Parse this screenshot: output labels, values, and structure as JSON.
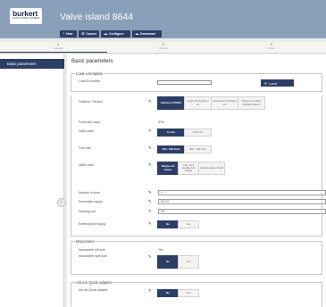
{
  "header": {
    "logo_word": "burkert",
    "logo_sub": "FLUID CONTROL SYSTEMS",
    "title": "Valve island 8644"
  },
  "toolbar": {
    "new_label": "New",
    "cancel_label": "Cancel",
    "configure_label": "Configure",
    "download_label": "Download"
  },
  "steps": [
    {
      "num": "1",
      "label": "General"
    },
    {
      "num": "2",
      "label": "Options"
    },
    {
      "num": "3",
      "label": "Done"
    }
  ],
  "sidebar": {
    "items": [
      {
        "label": "Basic parameters",
        "active": true
      }
    ]
  },
  "main": {
    "title": "Basic parameters",
    "template": {
      "legend": "Load a template",
      "field_label": "Load ID/number",
      "field_value": "",
      "load_label": "Load"
    },
    "params": {
      "fieldbus": {
        "label": "Fieldbus / Version",
        "options": [
          "Siemens ET200S",
          "Mega I/O System / ID",
          "Rockwell / CIA Point I/O",
          "Phoenix Contact INLINE System"
        ],
        "selected": 0
      },
      "protection": {
        "label": "Protection class",
        "value": "IP20"
      },
      "valve_width": {
        "label": "Valve width",
        "options": [
          "11 mm",
          "16.5 mm"
        ],
        "selected": 0
      },
      "flow_rate": {
        "label": "Flow rate",
        "options": [
          "200 - 300 l/min",
          "300 - 700 l/min"
        ],
        "selected": 0
      },
      "valve_sizes": {
        "label": "Valve sizes",
        "options": [
          "Single-coil valves",
          "Imp. and double-coil valves",
          "Combination of both"
        ],
        "selected": 0
      },
      "num_slots": {
        "label": "Number of slots",
        "value": "4"
      },
      "pneumatic_supply": {
        "label": "Pneumatic supply",
        "value": "SOYS"
      },
      "working_port": {
        "label": "Working port",
        "value": "D6"
      },
      "ext_pilot": {
        "label": "External pilot supply",
        "options": [
          "No",
          "Yes"
        ],
        "selected": 0
      }
    },
    "manometer": {
      "legend": "Manometer",
      "left_label": "Manometer left side",
      "left_value": "Yes",
      "right_label": "Manometer right side",
      "right_options": [
        "No",
        "Yes"
      ],
      "right_selected": 0
    },
    "airline": {
      "legend": "AirLine Quick adapter",
      "label": "AirLine Quick adapter",
      "options": [
        "No",
        "Yes"
      ],
      "selected": 0
    }
  },
  "colors": {
    "header": "#8aa0ba",
    "accent": "#2c3e66",
    "background": "#ecebe6"
  },
  "icons": {
    "new": "plus-icon",
    "cancel": "cancel-circle-icon",
    "configure": "cloud-gear-icon",
    "download": "cloud-download-icon",
    "edit": "pencil-icon",
    "load": "search-icon",
    "dropdown": "chevron-down-icon",
    "collapse": "chevron-left-icon"
  }
}
